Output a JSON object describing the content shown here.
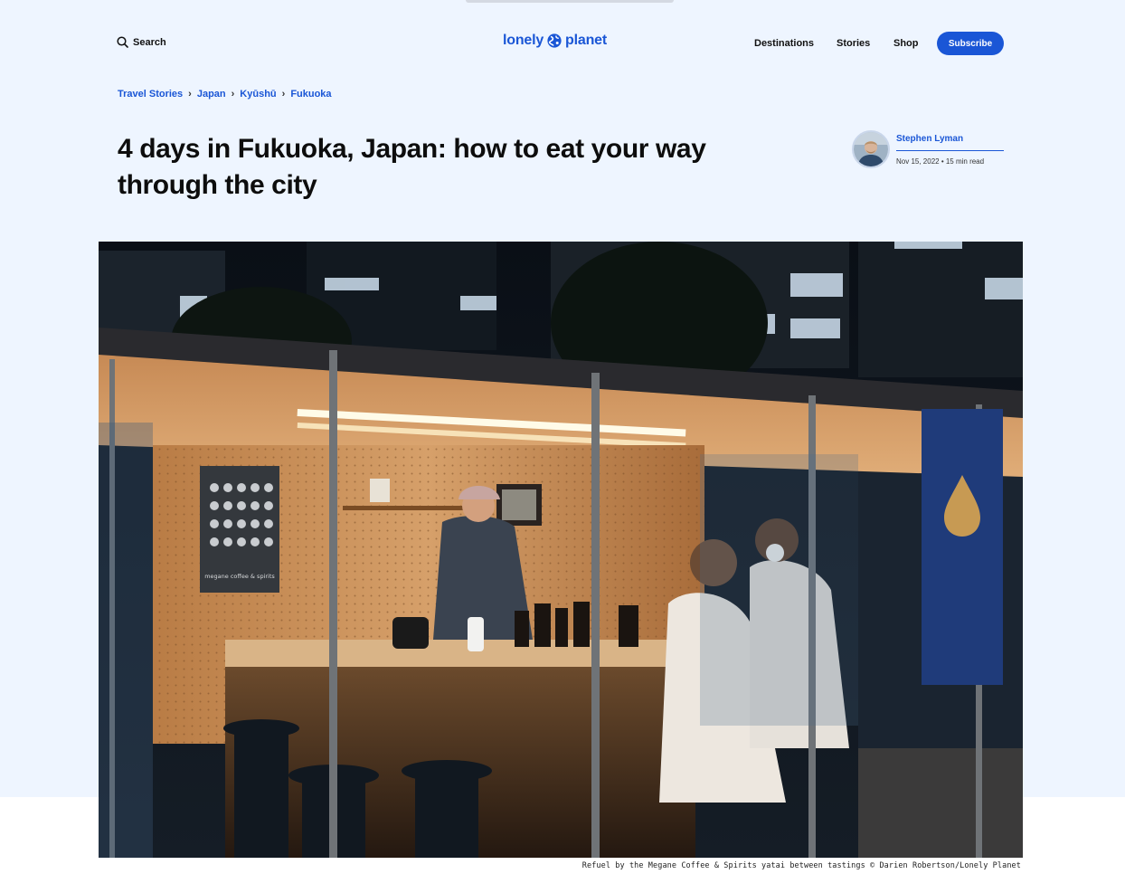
{
  "header": {
    "search_label": "Search",
    "logo_text_left": "lonely",
    "logo_text_right": "planet",
    "nav": [
      "Destinations",
      "Stories",
      "Shop"
    ],
    "subscribe_label": "Subscribe"
  },
  "breadcrumb": [
    "Travel Stories",
    "Japan",
    "Kyūshū",
    "Fukuoka"
  ],
  "article": {
    "title": "4 days in Fukuoka, Japan: how to eat your way through the city",
    "author": "Stephen Lyman",
    "date": "Nov 15, 2022",
    "read_time": "15 min read",
    "date_line": "Nov 15, 2022 • 15 min read"
  },
  "hero_image": {
    "banner_text": "megane coffee & spirits",
    "caption": "Refuel by the Megane Coffee & Spirits yatai between tastings © Darien Robertson/Lonely Planet"
  },
  "colors": {
    "accent": "#1a56d6",
    "hero_background": "#eef5ff"
  }
}
